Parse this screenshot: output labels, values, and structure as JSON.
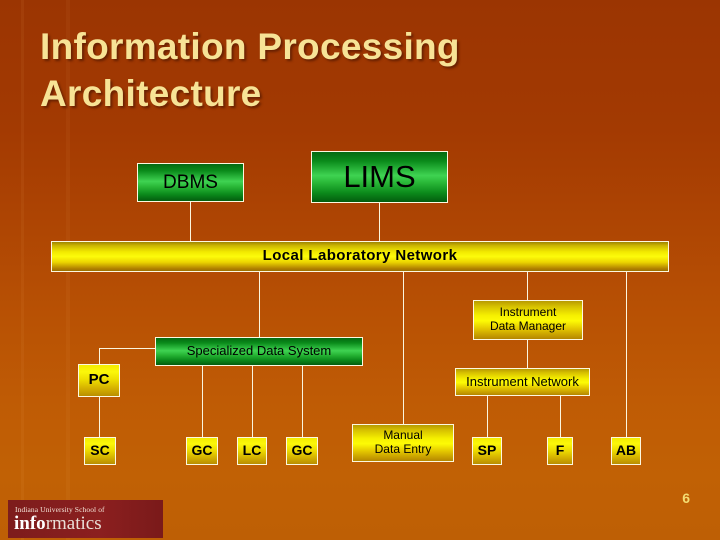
{
  "slide": {
    "title": "Information Processing\nArchitecture",
    "page_number": "6",
    "background_top_color": "#9b3502",
    "background_bottom_color": "#c16105",
    "title_color": "#f7e396"
  },
  "diagram": {
    "nodes": [
      {
        "id": "dbms",
        "label": "DBMS",
        "style": "green",
        "accent": "#28b636"
      },
      {
        "id": "lims",
        "label": "LIMS",
        "style": "green",
        "accent": "#28b636"
      },
      {
        "id": "network",
        "label": "Local Laboratory Network",
        "style": "yellow-bar",
        "accent": "#fdfc0a"
      },
      {
        "id": "idm",
        "label": "Instrument\nData Manager",
        "style": "yellow",
        "accent": "#fdfb05"
      },
      {
        "id": "sds",
        "label": "Specialized Data System",
        "style": "green",
        "accent": "#3fd352"
      },
      {
        "id": "pc",
        "label": "PC",
        "style": "yellow",
        "accent": "#fdfb05"
      },
      {
        "id": "inet",
        "label": "Instrument Network",
        "style": "yellow",
        "accent": "#fdfb05"
      },
      {
        "id": "sc",
        "label": "SC",
        "style": "yellow",
        "accent": "#fdfb05"
      },
      {
        "id": "gc1",
        "label": "GC",
        "style": "yellow",
        "accent": "#fdfb05"
      },
      {
        "id": "lc",
        "label": "LC",
        "style": "yellow",
        "accent": "#fdfb05"
      },
      {
        "id": "gc2",
        "label": "GC",
        "style": "yellow",
        "accent": "#fdfb05"
      },
      {
        "id": "manual",
        "label": "Manual\nData Entry",
        "style": "yellow",
        "accent": "#fdfb05"
      },
      {
        "id": "sp",
        "label": "SP",
        "style": "yellow",
        "accent": "#fdfb05"
      },
      {
        "id": "f",
        "label": "F",
        "style": "yellow",
        "accent": "#fdfb05"
      },
      {
        "id": "ab",
        "label": "AB",
        "style": "yellow",
        "accent": "#fdfb05"
      }
    ],
    "edges": [
      {
        "from": "dbms",
        "to": "network"
      },
      {
        "from": "lims",
        "to": "network"
      },
      {
        "from": "network",
        "to": "sds"
      },
      {
        "from": "network",
        "to": "idm"
      },
      {
        "from": "network",
        "to": "manual"
      },
      {
        "from": "network",
        "to": "ab"
      },
      {
        "from": "idm",
        "to": "inet"
      },
      {
        "from": "sds",
        "to": "pc"
      },
      {
        "from": "sds",
        "to": "gc1"
      },
      {
        "from": "sds",
        "to": "lc"
      },
      {
        "from": "sds",
        "to": "gc2"
      },
      {
        "from": "pc",
        "to": "sc"
      },
      {
        "from": "inet",
        "to": "sp"
      },
      {
        "from": "inet",
        "to": "f"
      }
    ],
    "connector_color": "#fbf6df",
    "border_color": "#fdf8e0"
  },
  "logo": {
    "line1": "Indiana University School of",
    "line2_bold": "info",
    "line2_rest": "rmatics",
    "background_color": "#7c1b1b"
  }
}
